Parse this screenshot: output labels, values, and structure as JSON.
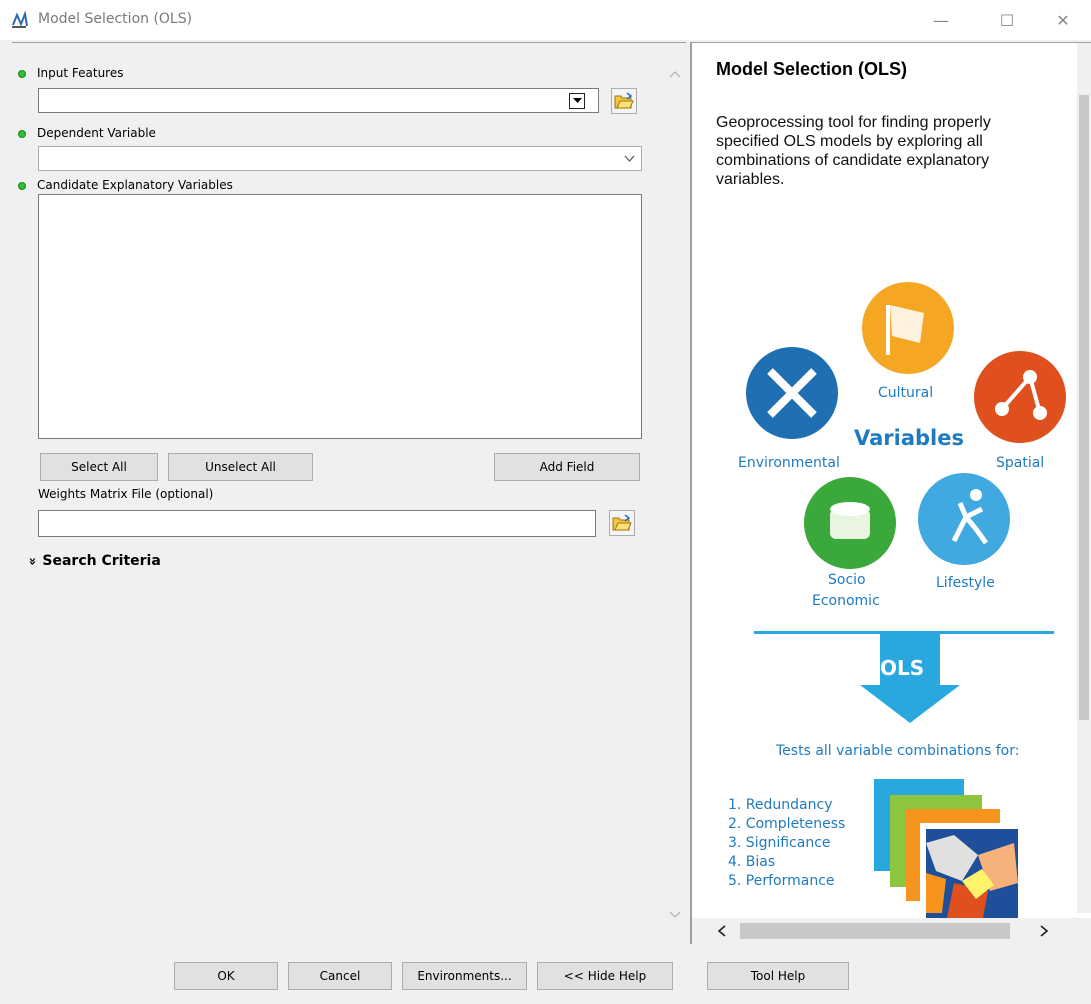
{
  "window": {
    "title": "Model Selection (OLS)",
    "minimize_glyph": "—",
    "maximize_glyph": "☐",
    "close_glyph": "✕"
  },
  "form": {
    "input_features": {
      "label": "Input Features",
      "value": ""
    },
    "dependent_variable": {
      "label": "Dependent Variable",
      "value": ""
    },
    "candidate_variables": {
      "label": "Candidate Explanatory Variables",
      "items": []
    },
    "buttons": {
      "select_all": "Select All",
      "unselect_all": "Unselect All",
      "add_field": "Add Field"
    },
    "weights_matrix": {
      "label": "Weights Matrix File (optional)",
      "value": ""
    },
    "search_criteria": {
      "label": "Search Criteria",
      "chevron": "»"
    }
  },
  "help": {
    "title": "Model Selection (OLS)",
    "description": "Geoprocessing tool for finding properly specified OLS models by exploring all combinations of candidate explanatory variables.",
    "diagram": {
      "center_label": "Variables",
      "categories": [
        "Cultural",
        "Environmental",
        "Spatial",
        "Socio",
        "Economic",
        "Lifestyle"
      ],
      "arrow_label": "OLS",
      "tests_heading": "Tests all variable combinations for:",
      "tests": [
        "1. Redundancy",
        "2. Completeness",
        "3. Significance",
        "4. Bias",
        "5. Performance"
      ],
      "colors": {
        "cultural": "#f5a623",
        "environmental": "#1f6fb2",
        "spatial": "#e0501e",
        "socio": "#3aa83a",
        "lifestyle": "#3fa9e0",
        "text_blue": "#1f7ac0",
        "accent": "#29a8e0"
      }
    }
  },
  "bottom": {
    "ok": "OK",
    "cancel": "Cancel",
    "environments": "Environments...",
    "hide_help": "<< Hide Help",
    "tool_help": "Tool Help"
  }
}
